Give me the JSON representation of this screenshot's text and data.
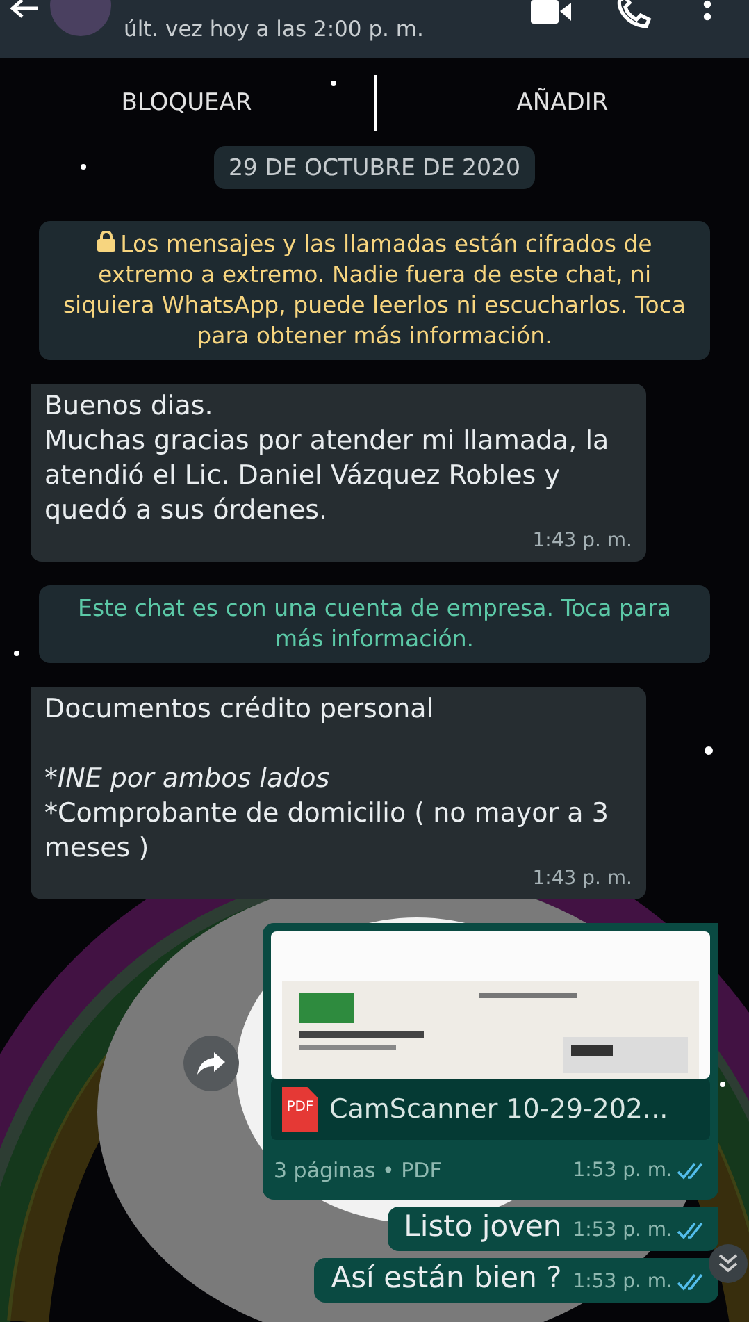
{
  "header": {
    "status": "últ. vez hoy a las 2:00 p. m."
  },
  "actions": [
    {
      "label": "BLOQUEAR"
    },
    {
      "label": "AÑADIR"
    }
  ],
  "date": "29 DE OCTUBRE DE 2020",
  "messages": [
    {
      "kind": "encryption",
      "text": "Los mensajes y las llamadas están cifrados de extremo a extremo. Nadie fuera de este chat, ni siquiera WhatsApp, puede leerlos ni escucharlos. Toca para obtener más información."
    },
    {
      "kind": "text",
      "outgoing": false,
      "paragraphs": [
        [
          {
            "text": "Buenos dias.",
            "italic": false
          },
          {
            "text": "Muchas gracias por atender mi llamada, la atendió el Lic. Daniel Vázquez Robles y quedó a sus órdenes.",
            "italic": false
          }
        ]
      ],
      "time": "1:43 p. m."
    },
    {
      "kind": "business",
      "text": "Este chat es con una cuenta de empresa. Toca para más información."
    },
    {
      "kind": "text",
      "outgoing": false,
      "paragraphs": [
        [
          {
            "text": "Documentos crédito personal",
            "italic": false
          }
        ],
        [
          {
            "text": "*INE por ambos lados",
            "italic": true
          },
          {
            "text": "*Comprobante de domicilio  ( no mayor a 3 meses )",
            "italic": false
          }
        ]
      ],
      "time": "1:43 p. m."
    },
    {
      "kind": "document",
      "outgoing": true,
      "file": "CamScanner 10-29-202...",
      "file_type": "PDF",
      "meta": "3 páginas • PDF",
      "time": "1:53 p. m.",
      "read": true
    },
    {
      "kind": "short",
      "outgoing": true,
      "text": "Listo joven",
      "time": "1:53 p. m.",
      "read": true
    },
    {
      "kind": "short",
      "outgoing": true,
      "text": "Así están bien ?",
      "time": "1:53 p. m.",
      "read": true
    }
  ]
}
